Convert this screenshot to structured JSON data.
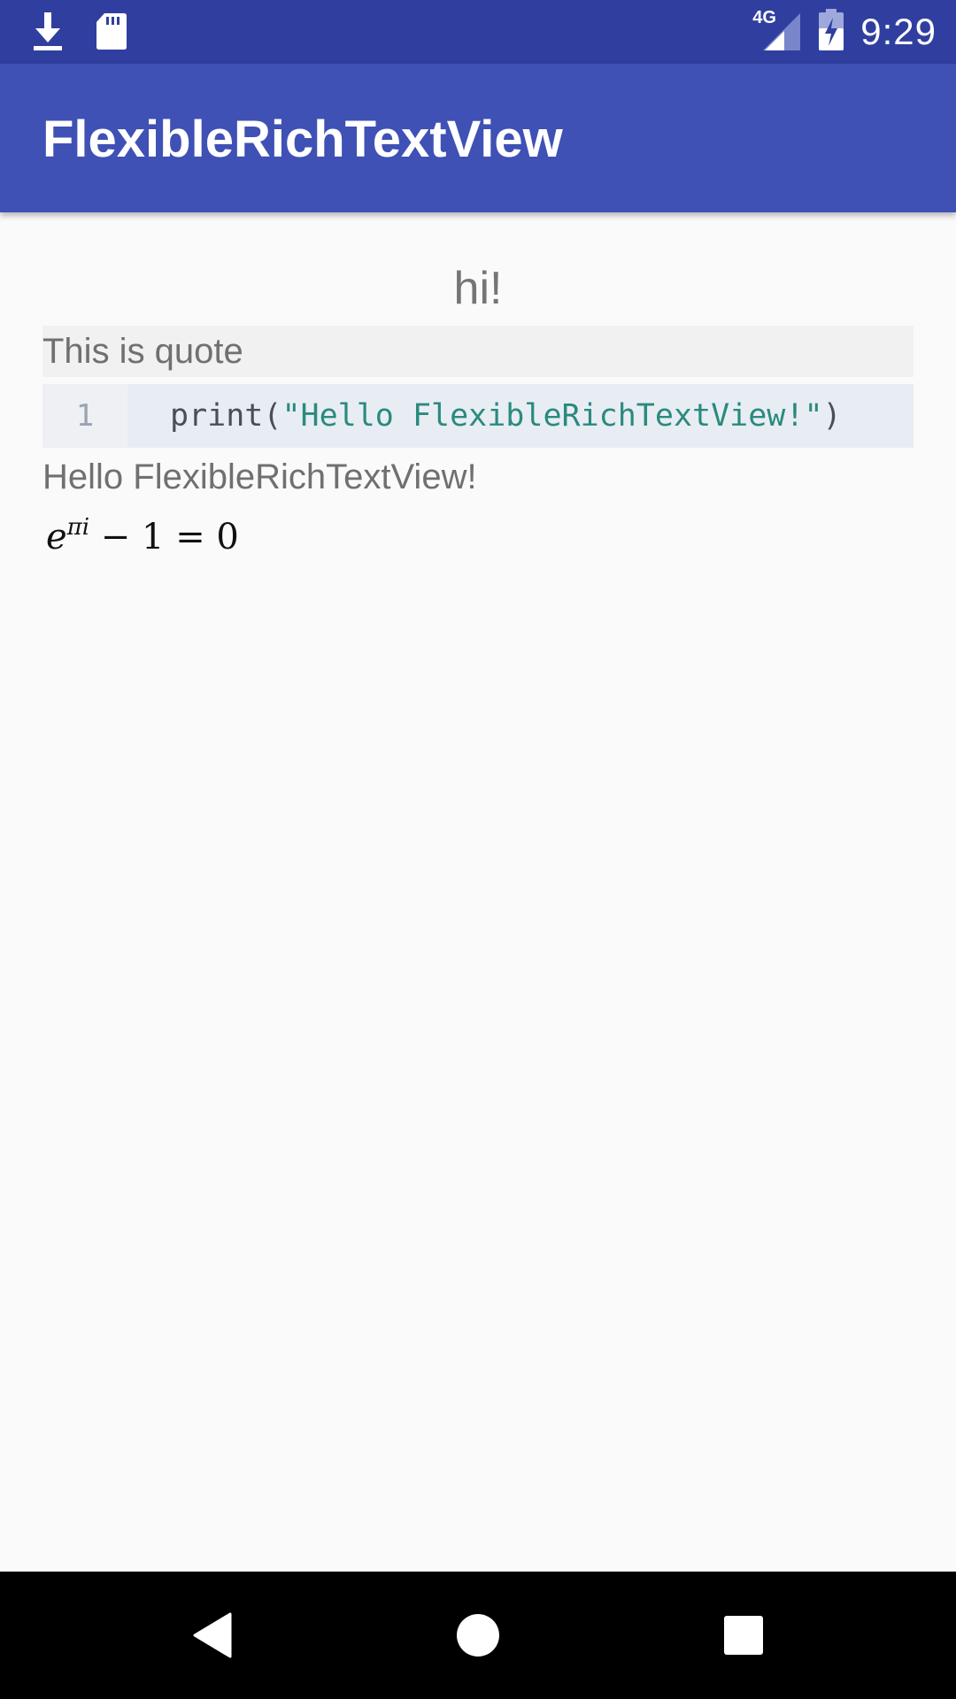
{
  "status_bar": {
    "left_icons": [
      "download-icon",
      "sd-card-icon"
    ],
    "network": "4G",
    "right_icons": [
      "cell-signal-icon",
      "battery-charging-icon"
    ],
    "time": "9:29"
  },
  "app_bar": {
    "title": "FlexibleRichTextView"
  },
  "content": {
    "heading": "hi!",
    "quote": "This is quote",
    "code": {
      "line_number": "1",
      "prefix": "print(",
      "string": "\"Hello FlexibleRichTextView!\"",
      "suffix": ")"
    },
    "paragraph": "Hello FlexibleRichTextView!",
    "math": {
      "base": "e",
      "exponent": "πi",
      "rest": " − 1 = 0"
    }
  },
  "nav_bar": {
    "buttons": [
      "back-icon",
      "home-icon",
      "recents-icon"
    ]
  },
  "colors": {
    "status_bar": "#303f9f",
    "app_bar": "#3f51b5",
    "background": "#fafafa",
    "quote_bg": "#f1f1f1",
    "code_bg": "#e8edf4",
    "code_string": "#2a8a7e"
  }
}
